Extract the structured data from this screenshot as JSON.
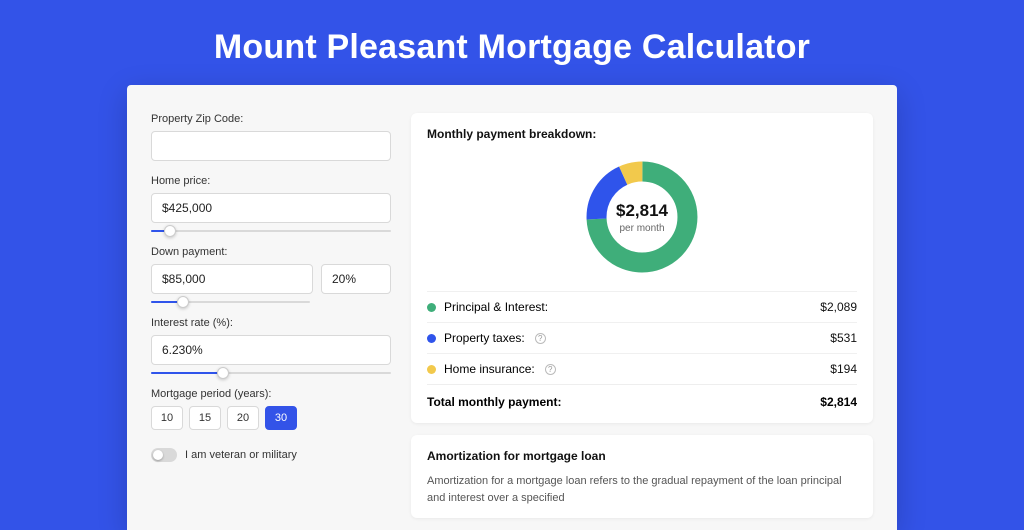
{
  "hero": {
    "title": "Mount Pleasant Mortgage Calculator"
  },
  "inputs": {
    "zip": {
      "label": "Property Zip Code:",
      "value": ""
    },
    "home_price": {
      "label": "Home price:",
      "value": "$425,000",
      "slider_pct": 8
    },
    "down_payment": {
      "label": "Down payment:",
      "value": "$85,000",
      "pct_value": "20%",
      "slider_pct": 20
    },
    "interest": {
      "label": "Interest rate (%):",
      "value": "6.230%",
      "slider_pct": 30
    },
    "period": {
      "label": "Mortgage period (years):",
      "options": [
        "10",
        "15",
        "20",
        "30"
      ],
      "selected": "30"
    },
    "veteran": {
      "label": "I am veteran or military",
      "checked": false
    }
  },
  "breakdown": {
    "title": "Monthly payment breakdown:",
    "center_amount": "$2,814",
    "center_sub": "per month",
    "items": [
      {
        "label": "Principal & Interest:",
        "value": "$2,089",
        "info": false
      },
      {
        "label": "Property taxes:",
        "value": "$531",
        "info": true
      },
      {
        "label": "Home insurance:",
        "value": "$194",
        "info": true
      }
    ],
    "total_label": "Total monthly payment:",
    "total_value": "$2,814"
  },
  "chart_data": {
    "type": "pie",
    "title": "Monthly payment breakdown",
    "series": [
      {
        "name": "Principal & Interest",
        "value": 2089,
        "color": "#3fae7a"
      },
      {
        "name": "Property taxes",
        "value": 531,
        "color": "#2f54eb"
      },
      {
        "name": "Home insurance",
        "value": 194,
        "color": "#f2c94c"
      }
    ],
    "total": 2814,
    "unit": "$ per month",
    "donut_inner_radius_pct": 62
  },
  "amortization": {
    "title": "Amortization for mortgage loan",
    "text": "Amortization for a mortgage loan refers to the gradual repayment of the loan principal and interest over a specified"
  }
}
